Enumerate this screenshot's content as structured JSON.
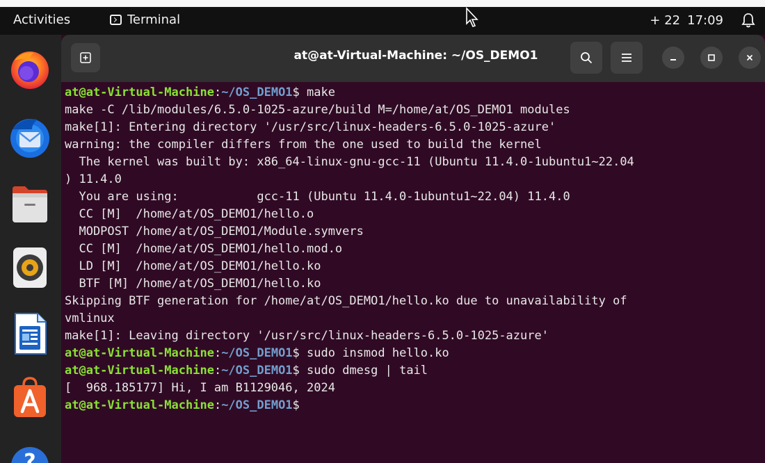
{
  "topbar": {
    "activities": "Activities",
    "app_name": "Terminal",
    "status": "+ 22",
    "time": "17:09"
  },
  "dock": {
    "apps": [
      "firefox-icon",
      "thunderbird-icon",
      "files-icon",
      "rhythmbox-icon",
      "libreoffice-writer-icon",
      "app-center-icon",
      "help-icon"
    ]
  },
  "window": {
    "title": "at@at-Virtual-Machine: ~/OS_DEMO1"
  },
  "colors": {
    "terminal_bg": "#300a24",
    "prompt_user": "#8ae234",
    "prompt_path": "#729fcf"
  },
  "terminal": {
    "prompt_user": "at@at-Virtual-Machine",
    "prompt_sep": ":",
    "prompt_path": "~/OS_DEMO1",
    "prompt_end": "$",
    "cmd1": " make",
    "out1": "make -C /lib/modules/6.5.0-1025-azure/build M=/home/at/OS_DEMO1 modules",
    "out2": "make[1]: Entering directory '/usr/src/linux-headers-6.5.0-1025-azure'",
    "out3": "warning: the compiler differs from the one used to build the kernel",
    "out4": "  The kernel was built by: x86_64-linux-gnu-gcc-11 (Ubuntu 11.4.0-1ubuntu1~22.04",
    "out5": ") 11.4.0",
    "out6": "  You are using:           gcc-11 (Ubuntu 11.4.0-1ubuntu1~22.04) 11.4.0",
    "out7": "  CC [M]  /home/at/OS_DEMO1/hello.o",
    "out8": "  MODPOST /home/at/OS_DEMO1/Module.symvers",
    "out9": "  CC [M]  /home/at/OS_DEMO1/hello.mod.o",
    "out10": "  LD [M]  /home/at/OS_DEMO1/hello.ko",
    "out11": "  BTF [M] /home/at/OS_DEMO1/hello.ko",
    "out12": "Skipping BTF generation for /home/at/OS_DEMO1/hello.ko due to unavailability of",
    "out13": "vmlinux",
    "out14": "make[1]: Leaving directory '/usr/src/linux-headers-6.5.0-1025-azure'",
    "cmd2": " sudo insmod hello.ko",
    "cmd3": " sudo dmesg | tail",
    "out15": "[  968.185177] Hi, I am B1129046, 2024"
  }
}
